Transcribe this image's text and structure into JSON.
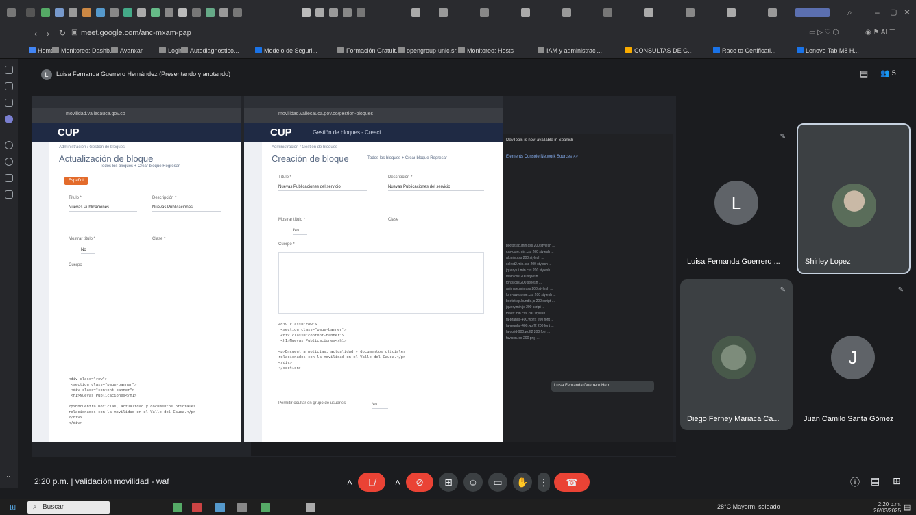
{
  "browser": {
    "url": "meet.google.com/anc-mxam-pap",
    "bookmarks": [
      {
        "label": "Home",
        "color": "#4285f4"
      },
      {
        "label": "Monitoreo: Dashb...",
        "color": "#8e8e8e"
      },
      {
        "label": "Avanxar",
        "color": "#8e8e8e"
      },
      {
        "label": "Login",
        "color": "#8e8e8e"
      },
      {
        "label": "Autodiagnostico...",
        "color": "#8e8e8e"
      },
      {
        "label": "Modelo de Seguri...",
        "color": "#1a73e8"
      },
      {
        "label": "Formación Gratuit...",
        "color": "#8e8e8e"
      },
      {
        "label": "opengroup-unic.sr...",
        "color": "#8e8e8e"
      },
      {
        "label": "Monitoreo: Hosts",
        "color": "#8e8e8e"
      },
      {
        "label": "IAM y administraci...",
        "color": "#8e8e8e"
      },
      {
        "label": "CONSULTAS DE G...",
        "color": "#f9ab00"
      },
      {
        "label": "Race to Certificati...",
        "color": "#1a73e8"
      },
      {
        "label": "Lenovo Tab M8 H...",
        "color": "#1a73e8"
      }
    ]
  },
  "meet": {
    "presenter_initial": "L",
    "presentation_label": "Luisa Fernanda Guerrero Hernández (Presentando y anotando)",
    "participant_count": "5",
    "participants": [
      {
        "name": "Luisa Fernanda Guerrero ...",
        "initial": "L",
        "color": "#5f6368"
      },
      {
        "name": "Shirley Lopez",
        "initial": "",
        "color": "#3c4043"
      },
      {
        "name": "Diego Ferney Mariaca Ca...",
        "initial": "",
        "color": "#3c4043"
      },
      {
        "name": "Juan Camilo Santa Gómez",
        "initial": "J",
        "color": "#3c4043"
      }
    ],
    "time": "2:20 p.m.",
    "meeting_title": "validación movilidad - waf"
  },
  "shared": {
    "left_window": {
      "logo": "CUP",
      "title": "Actualización de bloque",
      "crumb": "Administración  /  Gestión de bloques",
      "links": "Todos los bloques  + Crear bloque  Regresar",
      "btn": "Español",
      "field1_label": "Título *",
      "field1_value": "Nuevas Publicaciones",
      "field2_label": "Descripción *",
      "field2_value": "Nuevas Publicaciones",
      "field3_label": "Mostrar título *",
      "field3_value": "No",
      "field4_label": "Clase *",
      "field5_label": "Cuerpo",
      "code": "<div class=\"row\">\n <section class=\"page-banner\">\n <div class=\"content-banner\">\n <h1>Nuevas Publicaciones</h1>\n\n<p>Encuentra noticias, actualidad y documentos oficiales\nrelacionados con la movilidad en el Valle del Cauca.</p>\n</div>\n</div>"
    },
    "middle_window": {
      "logo": "CUP",
      "appbar_title": "Gestión de bloques - Creaci...",
      "title": "Creación de bloque",
      "crumb": "Administración  /  Gestión de bloques",
      "links": "Todos los bloques  + Crear bloque  Regresar",
      "field1_label": "Título *",
      "field1_value": "Nuevas Publicaciones del servicio",
      "field2_label": "Descripción *",
      "field2_value": "Nuevas Publicaciones del servicio",
      "field3_label": "Mostrar título *",
      "field3_value": "No",
      "field4_label": "Clase",
      "field5_label": "Cuerpo *",
      "code": "<div class=\"row\">\n <section class=\"page-banner\">\n <div class=\"content-banner\">\n <h1>Nuevas Publicaciones</h1>\n\n<p>Encuentra noticias, actualidad y documentos oficiales\nrelacionados con la movilidad en el Valle del Cauca.</p>\n</div>\n</section>",
      "bottom_label": "Permitir ocultar en grupo de usuarios",
      "bottom_value": "No"
    },
    "devtools": {
      "banner": "DevTools is now available in Spanish",
      "tabs": "Elements  Console  Network  Sources  >>",
      "rows": [
        "bootstrap.min.css   200  stylesh  ...",
        "css-core.min.css    200  stylesh  ...",
        "all.min.css         200  stylesh  ...",
        "select2.min.css     200  stylesh  ...",
        "jquery-ui.min.css   200  stylesh  ...",
        "main.css            200  stylesh  ...",
        "fonts.css           200  stylesh  ...",
        "animate.min.css     200  stylesh  ...",
        "font-awesome.css    200  stylesh  ...",
        "bootstrap.bundle.js 200  script   ...",
        "jquery.min.js       200  script   ...",
        "toastr.min.css      200  stylesh  ...",
        "fa-brands-400.woff2 200  font     ...",
        "fa-regular-400.woff2 200 font     ...",
        "fa-solid-900.woff2  200  font     ...",
        "favicon.ico         200  png      ..."
      ],
      "notification": "Luisa Fernanda Guerrero Hern..."
    }
  },
  "taskbar": {
    "search": "Buscar",
    "weather": "28°C  Mayorm. soleado",
    "clock_time": "2:20 p.m.",
    "clock_date": "26/03/2025"
  }
}
